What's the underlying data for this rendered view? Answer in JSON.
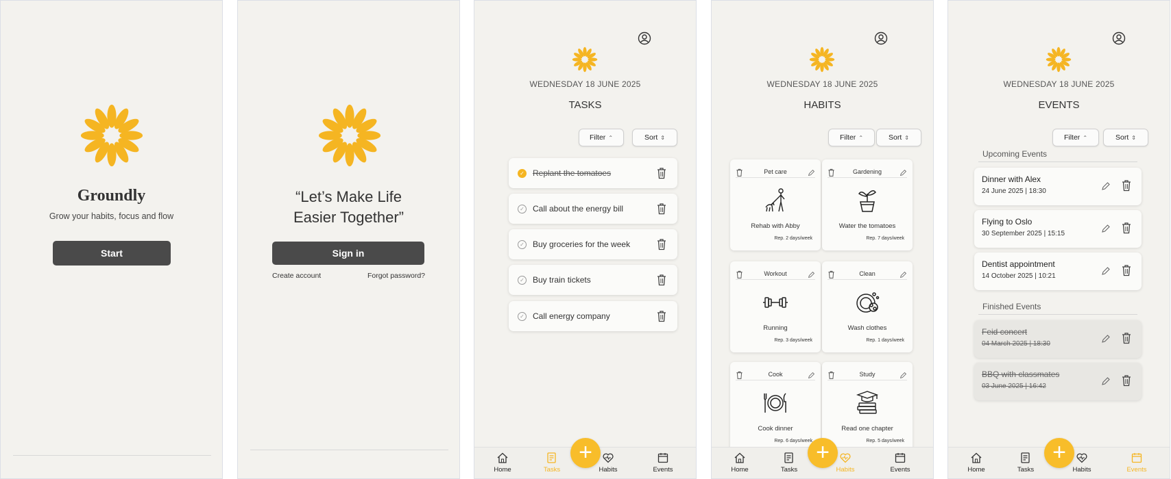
{
  "colors": {
    "accent": "#f5b522",
    "background": "#f3f2ee",
    "button": "#4a4a4a"
  },
  "splash": {
    "app_name": "Groundly",
    "tagline": "Grow your habits, focus and flow",
    "start_label": "Start"
  },
  "signin": {
    "quote_line1": "“Let’s Make Life",
    "quote_line2": "Easier Together”",
    "sign_in_label": "Sign in",
    "create_account": "Create account",
    "forgot_password": "Forgot password?"
  },
  "common": {
    "date": "WEDNESDAY 18 JUNE 2025",
    "filter": "Filter",
    "sort": "Sort",
    "fab": "+",
    "nav": {
      "home": "Home",
      "tasks": "Tasks",
      "habits": "Habits",
      "events": "Events"
    }
  },
  "tasks": {
    "title": "TASKS",
    "items": [
      {
        "label": "Replant the tomatoes",
        "done": true
      },
      {
        "label": "Call about the energy bill",
        "done": false
      },
      {
        "label": "Buy groceries for the week",
        "done": false
      },
      {
        "label": "Buy train tickets",
        "done": false
      },
      {
        "label": "Call energy company",
        "done": false
      }
    ]
  },
  "habits": {
    "title": "HABITS",
    "items": [
      {
        "category": "Pet care",
        "name": "Rehab with Abby",
        "rep": "Rep. 2 days/week",
        "icon": "dog-walk-icon"
      },
      {
        "category": "Gardening",
        "name": "Water the tomatoes",
        "rep": "Rep. 7 days/week",
        "icon": "potted-plant-icon"
      },
      {
        "category": "Workout",
        "name": "Running",
        "rep": "Rep. 3 days/week",
        "icon": "dumbbell-icon"
      },
      {
        "category": "Clean",
        "name": "Wash clothes",
        "rep": "Rep. 1 days/week",
        "icon": "washing-icon"
      },
      {
        "category": "Cook",
        "name": "Cook dinner",
        "rep": "Rep. 6 days/week",
        "icon": "plate-cutlery-icon"
      },
      {
        "category": "Study",
        "name": "Read one chapter",
        "rep": "Rep. 5 days/week",
        "icon": "graduation-books-icon"
      }
    ]
  },
  "events": {
    "title": "EVENTS",
    "upcoming_label": "Upcoming Events",
    "finished_label": "Finished Events",
    "upcoming": [
      {
        "title": "Dinner with Alex",
        "date": "24 June 2025 | 18:30"
      },
      {
        "title": "Flying to Oslo",
        "date": "30 September 2025 | 15:15"
      },
      {
        "title": "Dentist appointment",
        "date": "14 October 2025 | 10:21"
      }
    ],
    "finished": [
      {
        "title": "Feid concert",
        "date": "04 March 2025 | 18:30"
      },
      {
        "title": "BBQ with classmates",
        "date": "03 June 2025 | 16:42"
      }
    ]
  }
}
